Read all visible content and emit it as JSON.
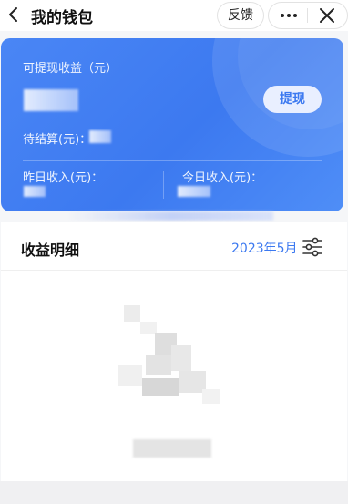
{
  "header": {
    "title": "我的钱包",
    "feedback_label": "反馈",
    "more_icon": "more-icon",
    "close_icon": "close-icon",
    "back_icon": "chevron-left-icon"
  },
  "wallet_card": {
    "withdrawable_label": "可提现收益（元）",
    "withdraw_button": "提现",
    "pending_label": "待结算(元)：",
    "yesterday_label": "昨日收入(元)：",
    "today_label": "今日收入(元)：",
    "accent_color": "#3c79f0"
  },
  "income_detail": {
    "title": "收益明细",
    "month": "2023年5月",
    "filter_icon": "filter-icon"
  }
}
